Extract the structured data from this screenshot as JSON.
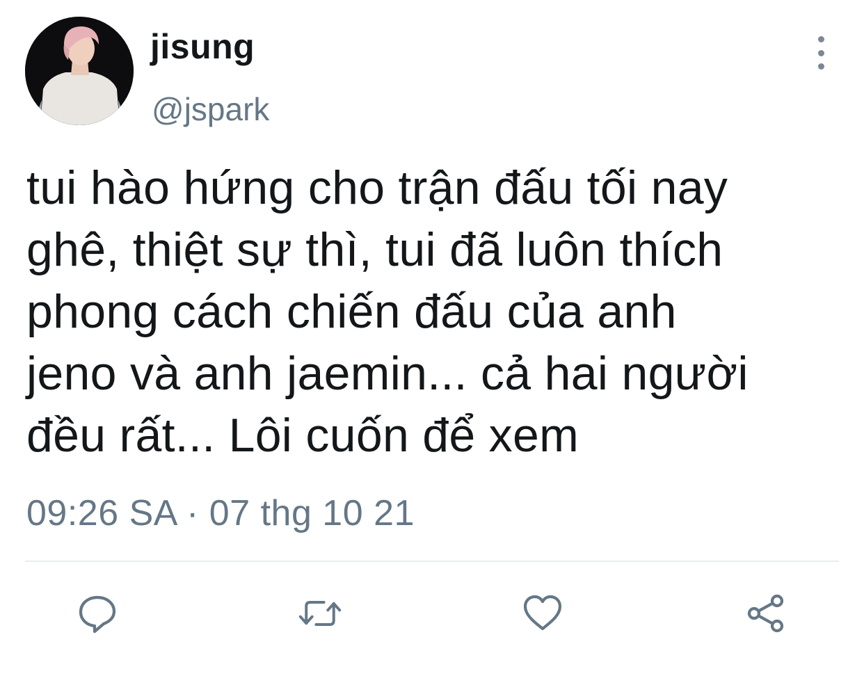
{
  "user": {
    "display_name": "jisung",
    "handle": "@jspark",
    "avatar_icon": "profile-photo"
  },
  "tweet": {
    "lines": [
      "tui hào hứng cho trận đấu tối nay",
      "ghê, thiệt sự thì, tui đã luôn thích",
      "phong cách chiến đấu của anh",
      "jeno và anh jaemin... cả hai người",
      "đều rất... Lôi cuốn để xem"
    ],
    "timestamp": "09:26 SA · 07 thg 10 21"
  },
  "actions": {
    "reply_icon": "reply-icon",
    "retweet_icon": "retweet-icon",
    "like_icon": "heart-icon",
    "share_icon": "share-icon"
  },
  "colors": {
    "text": "#14171a",
    "secondary": "#657786",
    "icon": "#657786",
    "divider": "#e6ecf0"
  }
}
